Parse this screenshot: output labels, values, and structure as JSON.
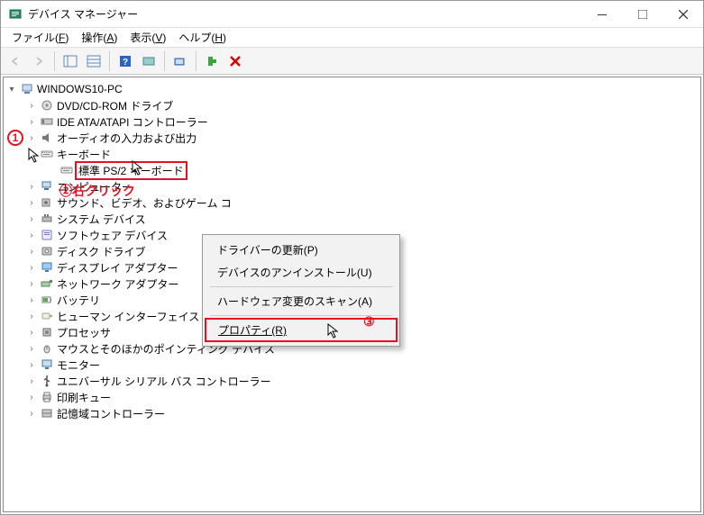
{
  "window": {
    "title": "デバイス マネージャー"
  },
  "menu": {
    "file": "ファイル(",
    "file_u": "F",
    "file2": ")",
    "action": "操作(",
    "action_u": "A",
    "action2": ")",
    "view": "表示(",
    "view_u": "V",
    "view2": ")",
    "help": "ヘルプ(",
    "help_u": "H",
    "help2": ")"
  },
  "tree": {
    "root": "WINDOWS10-PC",
    "items": [
      {
        "label": "DVD/CD-ROM ドライブ",
        "icon": "disc"
      },
      {
        "label": "IDE ATA/ATAPI コントローラー",
        "icon": "ide"
      },
      {
        "label": "オーディオの入力および出力",
        "icon": "audio"
      },
      {
        "label": "キーボード",
        "icon": "keyboard",
        "expanded": true
      },
      {
        "label": "標準 PS/2 キーボード",
        "icon": "keyboard",
        "child": true,
        "selected": true
      },
      {
        "label": "コンピューター",
        "icon": "computer"
      },
      {
        "label": "サウンド、ビデオ、およびゲーム コ",
        "icon": "sound"
      },
      {
        "label": "システム デバイス",
        "icon": "system"
      },
      {
        "label": "ソフトウェア デバイス",
        "icon": "software"
      },
      {
        "label": "ディスク ドライブ",
        "icon": "disk"
      },
      {
        "label": "ディスプレイ アダプター",
        "icon": "display"
      },
      {
        "label": "ネットワーク アダプター",
        "icon": "network"
      },
      {
        "label": "バッテリ",
        "icon": "battery"
      },
      {
        "label": "ヒューマン インターフェイス デバイス",
        "icon": "hid"
      },
      {
        "label": "プロセッサ",
        "icon": "cpu"
      },
      {
        "label": "マウスとそのほかのポインティング デバイス",
        "icon": "mouse"
      },
      {
        "label": "モニター",
        "icon": "monitor"
      },
      {
        "label": "ユニバーサル シリアル バス コントローラー",
        "icon": "usb"
      },
      {
        "label": "印刷キュー",
        "icon": "printer"
      },
      {
        "label": "記憶域コントローラー",
        "icon": "storage"
      }
    ]
  },
  "context_menu": {
    "items": [
      {
        "label": "ドライバーの更新(P)"
      },
      {
        "label": "デバイスのアンインストール(U)"
      },
      {
        "sep": true
      },
      {
        "label": "ハードウェア変更のスキャン(A)"
      },
      {
        "sep": true
      },
      {
        "label": "プロパティ(R)",
        "hl": true
      }
    ]
  },
  "annotations": {
    "n1": "1",
    "n2": "②右クリック",
    "n3": "③"
  }
}
